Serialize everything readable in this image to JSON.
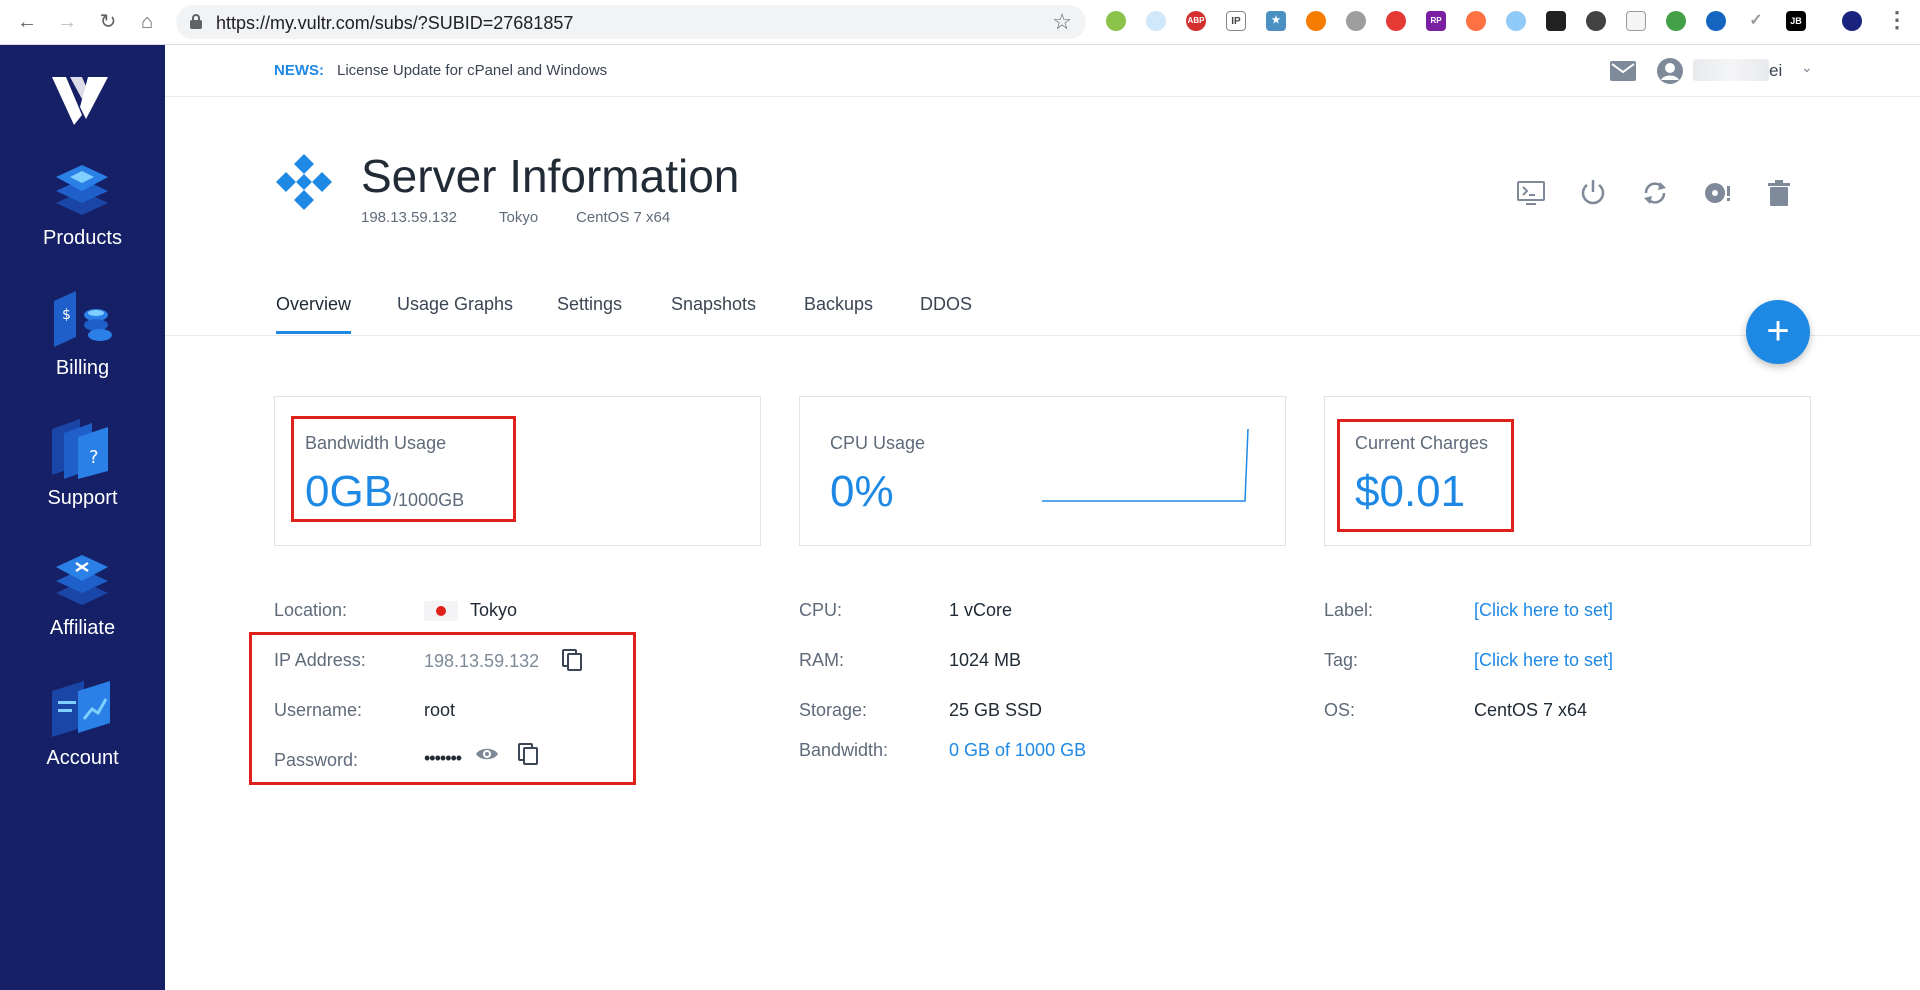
{
  "browser": {
    "url": "https://my.vultr.com/subs/?SUBID=27681857",
    "extensions": [
      "ABP",
      "IP",
      "RP",
      "JB"
    ]
  },
  "sidebar": {
    "items": [
      {
        "label": "Products"
      },
      {
        "label": "Billing"
      },
      {
        "label": "Support"
      },
      {
        "label": "Affiliate"
      },
      {
        "label": "Account"
      }
    ]
  },
  "topbar": {
    "news_label": "NEWS:",
    "news_text": "License Update for cPanel and Windows",
    "user_name": "ei"
  },
  "header": {
    "title": "Server Information",
    "ip": "198.13.59.132",
    "location": "Tokyo",
    "os": "CentOS 7 x64"
  },
  "tabs": [
    {
      "label": "Overview",
      "active": true
    },
    {
      "label": "Usage Graphs"
    },
    {
      "label": "Settings"
    },
    {
      "label": "Snapshots"
    },
    {
      "label": "Backups"
    },
    {
      "label": "DDOS"
    }
  ],
  "cards": {
    "bandwidth": {
      "label": "Bandwidth Usage",
      "value": "0GB",
      "suffix": "/1000GB"
    },
    "cpu": {
      "label": "CPU Usage",
      "value": "0%"
    },
    "charges": {
      "label": "Current Charges",
      "value": "$0.01"
    }
  },
  "details": {
    "location": {
      "label": "Location:",
      "value": "Tokyo"
    },
    "ip": {
      "label": "IP Address:",
      "value": "198.13.59.132"
    },
    "username": {
      "label": "Username:",
      "value": "root"
    },
    "password": {
      "label": "Password:",
      "value": "•••••••"
    },
    "cpu": {
      "label": "CPU:",
      "value": "1 vCore"
    },
    "ram": {
      "label": "RAM:",
      "value": "1024 MB"
    },
    "storage": {
      "label": "Storage:",
      "value": "25 GB SSD"
    },
    "bandwidth": {
      "label": "Bandwidth:",
      "value": "0 GB of 1000 GB"
    },
    "label": {
      "label": "Label:",
      "value": "[Click here to set]"
    },
    "tag": {
      "label": "Tag:",
      "value": "[Click here to set]"
    },
    "os": {
      "label": "OS:",
      "value": "CentOS 7 x64"
    }
  },
  "colors": {
    "sidebar": "#152066",
    "accent": "#1e88e5",
    "highlight": "#e0201a"
  }
}
